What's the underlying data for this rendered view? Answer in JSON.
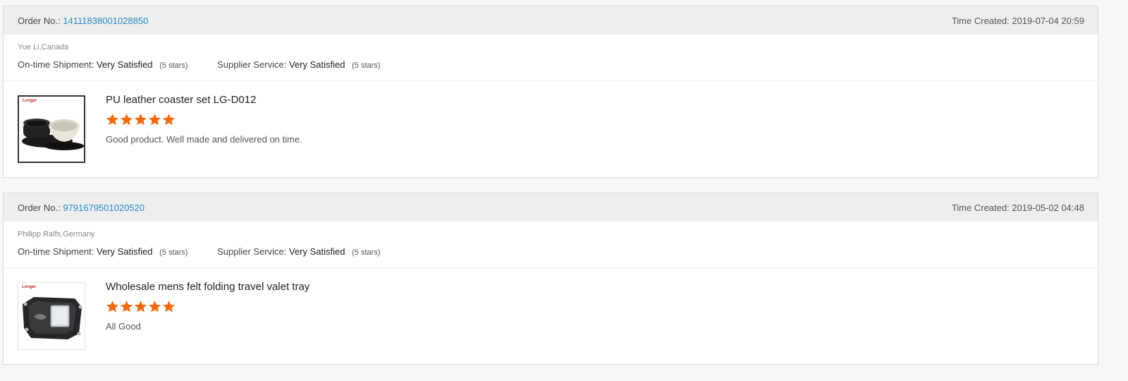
{
  "colors": {
    "link": "#2a8bc2",
    "star": "#f26a10",
    "header_bg": "#eeeeee"
  },
  "labels": {
    "order_no": "Order No.:",
    "time_created": "Time Created:",
    "ontime_shipment": "On-time Shipment:",
    "supplier_service": "Supplier Service:"
  },
  "reviews": [
    {
      "order_number": "14111838001028850",
      "time_created": "2019-07-04 20:59",
      "buyer": "Yue Li,Canada",
      "ontime_shipment": "Very Satisfied",
      "ontime_stars": "(5 stars)",
      "supplier_service": "Very Satisfied",
      "supplier_stars": "(5 stars)",
      "product_title": "PU leather coaster set LG-D012",
      "thumb_brand": "Longer",
      "rating": 5,
      "comment": "Good product. Well made and delivered on time."
    },
    {
      "order_number": "9791679501020520",
      "time_created": "2019-05-02 04:48",
      "buyer": "Philipp Ralfs,Germany",
      "ontime_shipment": "Very Satisfied",
      "ontime_stars": "(5 stars)",
      "supplier_service": "Very Satisfied",
      "supplier_stars": "(5 stars)",
      "product_title": "Wholesale mens felt folding travel valet tray",
      "thumb_brand": "Longer",
      "rating": 5,
      "comment": "All Good"
    }
  ]
}
